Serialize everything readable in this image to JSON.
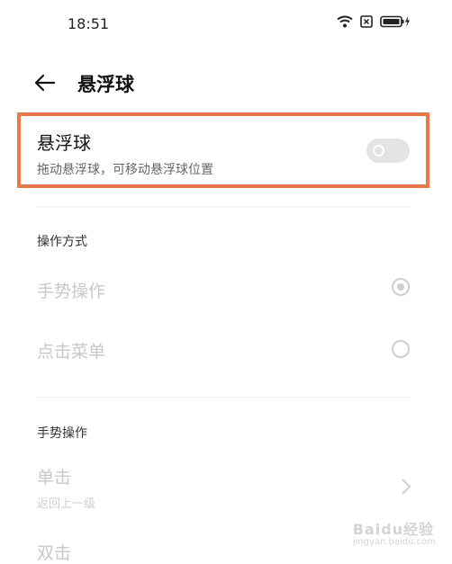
{
  "status_bar": {
    "time": "18:51",
    "icons": [
      "wifi-icon",
      "sim-blocked-icon",
      "battery-charging-icon"
    ]
  },
  "header": {
    "title": "悬浮球",
    "back_icon": "back-arrow-icon"
  },
  "floating_ball": {
    "title": "悬浮球",
    "description": "拖动悬浮球，可移动悬浮球位置",
    "toggle_enabled": false
  },
  "operation_mode": {
    "section_label": "操作方式",
    "options": [
      {
        "label": "手势操作",
        "selected": true
      },
      {
        "label": "点击菜单",
        "selected": false
      }
    ]
  },
  "gesture_operations": {
    "section_label": "手势操作",
    "items": [
      {
        "label": "单击",
        "sub": "返回上一级"
      },
      {
        "label": "双击",
        "sub": ""
      }
    ]
  },
  "watermark": {
    "text": "Baidu经验",
    "sub": "jingyan.baidu.com"
  },
  "colors": {
    "highlight_border": "#e8794a",
    "disabled_text": "#c8c8c8",
    "toggle_off": "#e4e4e4"
  }
}
